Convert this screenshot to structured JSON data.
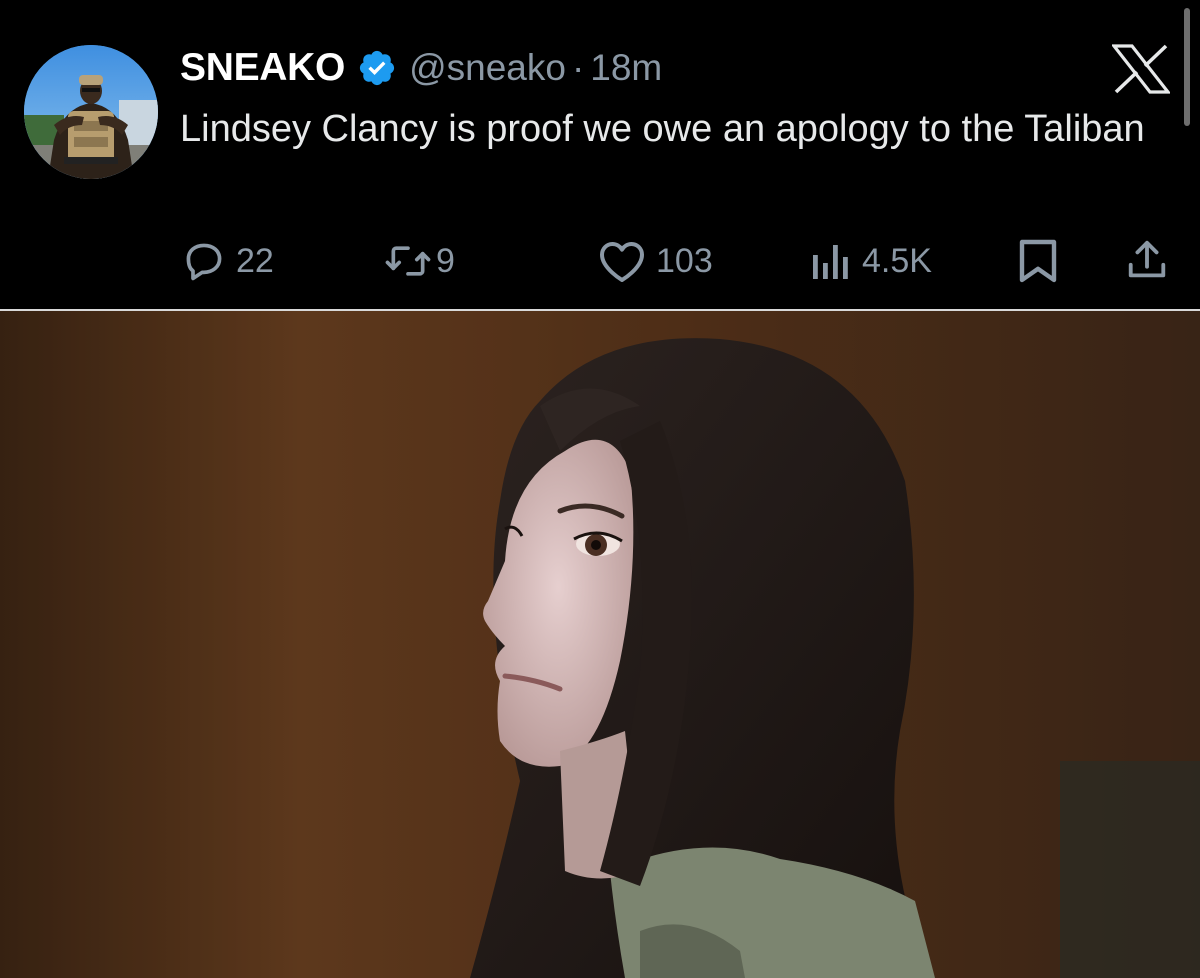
{
  "tweet": {
    "display_name": "SNEAKO",
    "handle": "@sneako",
    "separator": "·",
    "time": "18m",
    "text": "Lindsey Clancy is proof we owe an apology to the Taliban",
    "actions": {
      "replies": "22",
      "reposts": "9",
      "likes": "103",
      "views": "4.5K"
    }
  },
  "icons": {
    "verified": "verified-badge-icon",
    "reply": "speech-bubble-icon",
    "repost": "repost-arrows-icon",
    "like": "heart-icon",
    "views": "bar-chart-icon",
    "bookmark": "bookmark-icon",
    "share": "share-upload-icon",
    "brand": "x-logo-icon"
  },
  "colors": {
    "background": "#000000",
    "text_primary": "#e7e9ea",
    "text_secondary": "#8b98a5",
    "verified": "#1d9bf0"
  }
}
